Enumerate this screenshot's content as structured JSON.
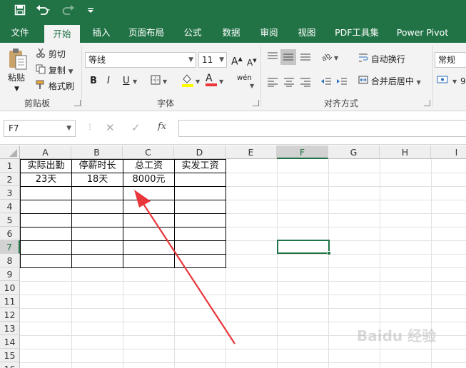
{
  "qat": {
    "save_icon": "save-icon",
    "undo_icon": "undo-icon",
    "redo_icon": "redo-icon",
    "customize_icon": "customize-icon"
  },
  "tabs": [
    {
      "label": "文件"
    },
    {
      "label": "开始"
    },
    {
      "label": "插入"
    },
    {
      "label": "页面布局"
    },
    {
      "label": "公式"
    },
    {
      "label": "数据"
    },
    {
      "label": "审阅"
    },
    {
      "label": "视图"
    },
    {
      "label": "PDF工具集"
    },
    {
      "label": "Power Pivot"
    }
  ],
  "active_tab": "开始",
  "ribbon": {
    "clipboard": {
      "paste": "粘贴",
      "cut": "剪切",
      "copy": "复制",
      "format_painter": "格式刷",
      "group": "剪贴板"
    },
    "font": {
      "name": "等线",
      "size": "11",
      "group": "字体",
      "bold": "B",
      "italic": "I",
      "underline": "U",
      "font_grow": "A",
      "font_shrink": "A",
      "color_letter": "A",
      "phonetic": "wén"
    },
    "alignment": {
      "wrap": "自动换行",
      "merge": "合并后居中",
      "group": "对齐方式"
    },
    "number": {
      "format": "常规"
    }
  },
  "formula_bar": {
    "name_box": "F7",
    "fx": "fx",
    "formula": ""
  },
  "columns": [
    "A",
    "B",
    "C",
    "D",
    "E",
    "F",
    "G",
    "H",
    "I"
  ],
  "rows": [
    "1",
    "2",
    "3",
    "4",
    "5",
    "6",
    "7",
    "8",
    "9",
    "10",
    "11",
    "12",
    "13",
    "14",
    "15",
    "16"
  ],
  "cells": {
    "A1": "实际出勤",
    "B1": "停薪时长",
    "C1": "总工资",
    "D1": "实发工资",
    "A2": "23天",
    "B2": "18天",
    "C2": "8000元"
  },
  "selected_cell": "F7",
  "colors": {
    "brand_green": "#217346",
    "arrow_red": "#e8363b"
  },
  "watermark": "Baidu 经验"
}
